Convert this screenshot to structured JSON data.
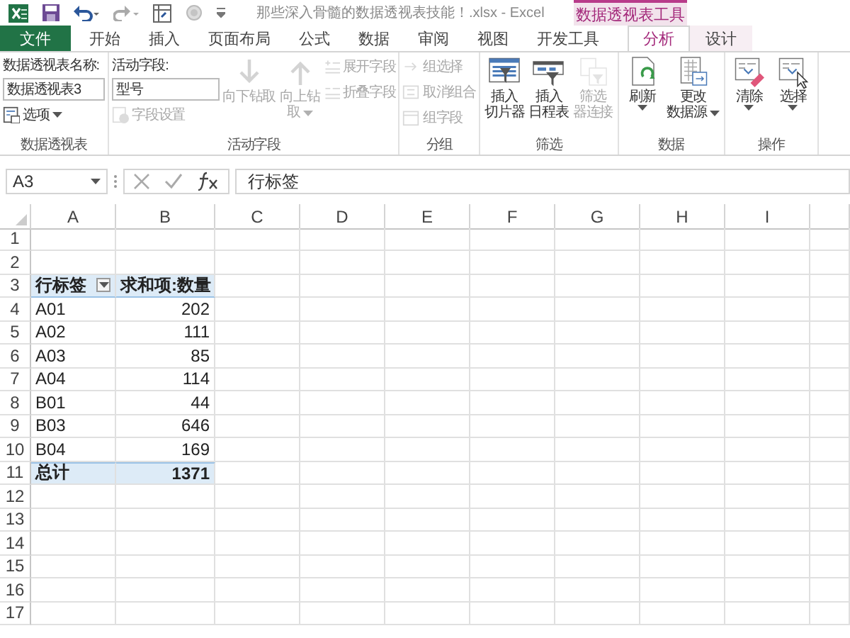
{
  "title_bar": {
    "title": "那些深入骨髓的数据透视表技能！.xlsx - Excel",
    "context_label": "数据透视表工具"
  },
  "tabs": [
    {
      "label": "文件",
      "kind": "file",
      "selected": false
    },
    {
      "label": "开始",
      "kind": "normal",
      "selected": false
    },
    {
      "label": "插入",
      "kind": "normal",
      "selected": false
    },
    {
      "label": "页面布局",
      "kind": "normal",
      "selected": false
    },
    {
      "label": "公式",
      "kind": "normal",
      "selected": false
    },
    {
      "label": "数据",
      "kind": "normal",
      "selected": false
    },
    {
      "label": "审阅",
      "kind": "normal",
      "selected": false
    },
    {
      "label": "视图",
      "kind": "normal",
      "selected": false
    },
    {
      "label": "开发工具",
      "kind": "normal",
      "selected": false
    },
    {
      "label": "分析",
      "kind": "context",
      "selected": true
    },
    {
      "label": "设计",
      "kind": "context",
      "selected": false
    }
  ],
  "ribbon_groups": [
    {
      "label": "数据透视表",
      "columns": [
        [
          {
            "kind": "label",
            "text": "数据透视表名称:"
          },
          {
            "kind": "field",
            "value": "数据透视表3"
          },
          {
            "kind": "small",
            "label": "选项",
            "dropdown": true,
            "disabled": false
          }
        ]
      ]
    },
    {
      "label": "活动字段",
      "columns": [
        [
          {
            "kind": "label",
            "text": "活动字段:"
          },
          {
            "kind": "field",
            "value": "型号"
          },
          {
            "kind": "small",
            "label": "字段设置",
            "dropdown": false,
            "disabled": true
          }
        ],
        [
          {
            "kind": "large",
            "lines": [
              "向下钻取"
            ],
            "dropdown": false,
            "disabled": true
          }
        ],
        [
          {
            "kind": "large",
            "lines": [
              "向上钻",
              "取"
            ],
            "dropdown": true,
            "disabled": true
          }
        ],
        [
          {
            "kind": "small",
            "label": "展开字段",
            "dropdown": false,
            "disabled": true
          },
          {
            "kind": "small",
            "label": "折叠字段",
            "dropdown": false,
            "disabled": true
          }
        ]
      ]
    },
    {
      "label": "分组",
      "columns": [
        [
          {
            "kind": "small",
            "label": "组选择",
            "dropdown": false,
            "disabled": true
          },
          {
            "kind": "small",
            "label": "取消组合",
            "dropdown": false,
            "disabled": true
          },
          {
            "kind": "small",
            "label": "组字段",
            "dropdown": false,
            "disabled": true
          }
        ]
      ]
    },
    {
      "label": "筛选",
      "columns": [
        [
          {
            "kind": "large",
            "lines": [
              "插入",
              "切片器"
            ],
            "dropdown": false,
            "disabled": false
          }
        ],
        [
          {
            "kind": "large",
            "lines": [
              "插入",
              "日程表"
            ],
            "dropdown": false,
            "disabled": false
          }
        ],
        [
          {
            "kind": "large",
            "lines": [
              "筛选",
              "器连接"
            ],
            "dropdown": false,
            "disabled": true
          }
        ]
      ]
    },
    {
      "label": "数据",
      "columns": [
        [
          {
            "kind": "large",
            "lines": [
              "刷新"
            ],
            "dropdown": true,
            "disabled": false
          }
        ],
        [
          {
            "kind": "large",
            "lines": [
              "更改",
              "数据源"
            ],
            "dropdown": true,
            "disabled": false
          }
        ]
      ]
    },
    {
      "label": "操作",
      "columns": [
        [
          {
            "kind": "large",
            "lines": [
              "清除"
            ],
            "dropdown": true,
            "disabled": false
          }
        ],
        [
          {
            "kind": "large",
            "lines": [
              "选择"
            ],
            "dropdown": true,
            "disabled": false
          }
        ]
      ]
    }
  ],
  "formula_bar": {
    "name_box": "A3",
    "formula": "行标签"
  },
  "sheet": {
    "columns": [
      "A",
      "B",
      "C",
      "D",
      "E",
      "F",
      "G",
      "H",
      "I"
    ],
    "rows": [
      {
        "number": "1",
        "kind": "blank"
      },
      {
        "number": "2",
        "kind": "blank"
      },
      {
        "number": "3",
        "kind": "header",
        "label": "行标签",
        "value": "求和项:数量"
      },
      {
        "number": "4",
        "kind": "item",
        "label": "A01",
        "value": "202"
      },
      {
        "number": "5",
        "kind": "item",
        "label": "A02",
        "value": "111"
      },
      {
        "number": "6",
        "kind": "item",
        "label": "A03",
        "value": "85"
      },
      {
        "number": "7",
        "kind": "item",
        "label": "A04",
        "value": "114"
      },
      {
        "number": "8",
        "kind": "item",
        "label": "B01",
        "value": "44"
      },
      {
        "number": "9",
        "kind": "item",
        "label": "B03",
        "value": "646"
      },
      {
        "number": "10",
        "kind": "item",
        "label": "B04",
        "value": "169"
      },
      {
        "number": "11",
        "kind": "total",
        "label": "总计",
        "value": "1371"
      },
      {
        "number": "12",
        "kind": "blank"
      },
      {
        "number": "13",
        "kind": "blank"
      },
      {
        "number": "14",
        "kind": "blank"
      },
      {
        "number": "15",
        "kind": "blank"
      },
      {
        "number": "16",
        "kind": "blank"
      },
      {
        "number": "17",
        "kind": "blank"
      }
    ]
  }
}
